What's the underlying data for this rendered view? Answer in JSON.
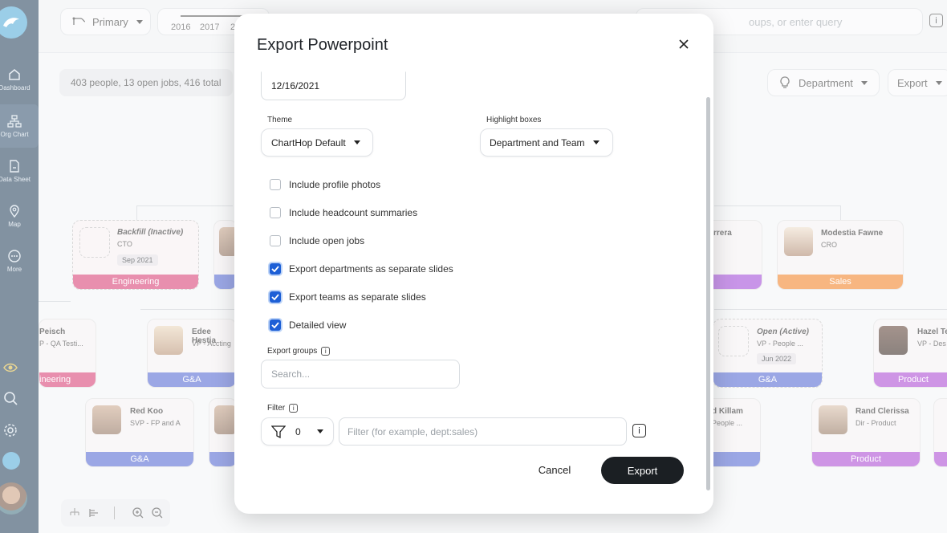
{
  "nav": {
    "items": [
      {
        "label": "Dashboard",
        "icon": "home-icon"
      },
      {
        "label": "Org Chart",
        "icon": "org-chart-icon"
      },
      {
        "label": "Data Sheet",
        "icon": "data-sheet-icon"
      },
      {
        "label": "Map",
        "icon": "map-pin-icon"
      },
      {
        "label": "More",
        "icon": "more-icon"
      }
    ]
  },
  "topbar": {
    "scenario_label": "Primary",
    "years": [
      "2016",
      "2017",
      "2"
    ],
    "search_placeholder": "oups, or enter query"
  },
  "summary": "403 people, 13 open jobs, 416 total",
  "header_buttons": {
    "department": "Department",
    "export": "Export"
  },
  "cards": {
    "backfill": {
      "name": "Backfill (Inactive)",
      "role": "CTO",
      "date": "Sep 2021",
      "dept": "Engineering"
    },
    "reisch": {
      "name": "Peisch",
      "role": "P - QA Testi...",
      "dept": "ineering"
    },
    "edee": {
      "name": "Edee Hestia",
      "role": "VP - Accting",
      "dept": "G&A"
    },
    "redkoo": {
      "name": "Red Koo",
      "role": "SVP - FP and A",
      "dept": "G&A"
    },
    "rrera": {
      "name": "rrera"
    },
    "modestia": {
      "name": "Modestia Fawne",
      "role": "CRO",
      "dept": "Sales"
    },
    "open": {
      "name": "Open (Active)",
      "role": "VP - People ...",
      "date": "Jun 2022",
      "dept": "G&A"
    },
    "killam": {
      "name": "d Killam",
      "role": "People ..."
    },
    "hazel": {
      "name": "Hazel Te",
      "role": "VP - Des",
      "dept": "Product"
    },
    "rand": {
      "name": "Rand Clerissa",
      "role": "Dir - Product",
      "dept": "Product"
    }
  },
  "modal": {
    "title": "Export Powerpoint",
    "date_value": "12/16/2021",
    "theme_label": "Theme",
    "theme_value": "ChartHop Default",
    "highlight_label": "Highlight boxes",
    "highlight_value": "Department and Team",
    "checkboxes": [
      {
        "label": "Include profile photos",
        "checked": false
      },
      {
        "label": "Include headcount summaries",
        "checked": false
      },
      {
        "label": "Include open jobs",
        "checked": false
      },
      {
        "label": "Export departments as separate slides",
        "checked": true
      },
      {
        "label": "Export teams as separate slides",
        "checked": true
      },
      {
        "label": "Detailed view",
        "checked": true
      }
    ],
    "export_groups_label": "Export groups",
    "export_groups_placeholder": "Search...",
    "filter_label": "Filter",
    "filter_count": "0",
    "filter_placeholder": "Filter (for example, dept:sales)",
    "cancel_label": "Cancel",
    "export_label": "Export"
  },
  "colors": {
    "engineering": "#d6336c",
    "ga": "#4a5fcf",
    "sales": "#f07a1a",
    "product": "#a63fcf",
    "purple": "#9c3fd6",
    "primary_btn": "#1b1f23",
    "checkbox": "#1d5fd6"
  },
  "info_glyph": "i"
}
